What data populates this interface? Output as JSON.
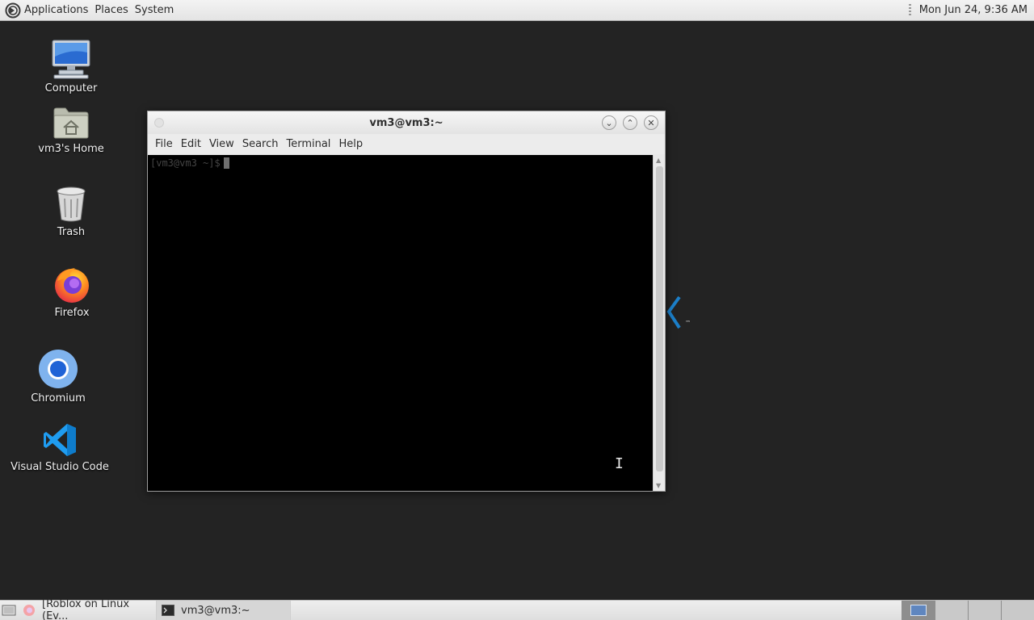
{
  "top_panel": {
    "menus": [
      "Applications",
      "Places",
      "System"
    ],
    "clock": "Mon Jun 24,  9:36 AM"
  },
  "desktop": {
    "icons": [
      {
        "label": "Computer",
        "icon": "computer-icon"
      },
      {
        "label": "vm3's Home",
        "icon": "home-folder-icon"
      },
      {
        "label": "Trash",
        "icon": "trash-icon"
      },
      {
        "label": "Firefox",
        "icon": "firefox-icon"
      },
      {
        "label": "Chromium",
        "icon": "chromium-icon"
      },
      {
        "label": "Visual Studio Code",
        "icon": "vscode-icon"
      }
    ],
    "bg_fragment_tm": "™"
  },
  "terminal": {
    "title": "vm3@vm3:~",
    "menu": [
      "File",
      "Edit",
      "View",
      "Search",
      "Terminal",
      "Help"
    ],
    "prompt": "[vm3@vm3 ~]$",
    "window_buttons": {
      "minimize": "⌄",
      "maximize": "⌃",
      "close": "✕"
    }
  },
  "taskbar": {
    "tasks": [
      {
        "label": "[Roblox on Linux (Ev...",
        "icon": "firefox-icon"
      },
      {
        "label": "vm3@vm3:~",
        "icon": "terminal-icon"
      }
    ],
    "workspaces": 4,
    "active_workspace": 1
  },
  "colors": {
    "desktop_bg": "#232323",
    "panel_bg": "#e8e8e8",
    "terminal_bg": "#000000",
    "vscode_blue": "#1f9cf0"
  }
}
